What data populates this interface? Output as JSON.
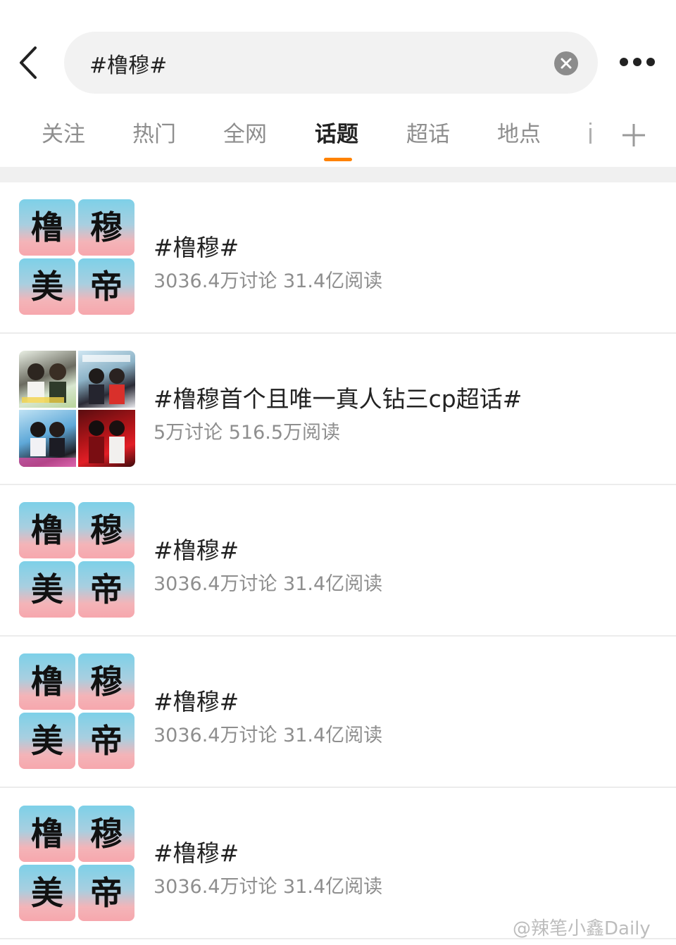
{
  "search": {
    "query": "#橹穆#"
  },
  "tabs": [
    {
      "label": "关注",
      "active": false
    },
    {
      "label": "热门",
      "active": false
    },
    {
      "label": "全网",
      "active": false
    },
    {
      "label": "话题",
      "active": true
    },
    {
      "label": "超话",
      "active": false
    },
    {
      "label": "地点",
      "active": false
    }
  ],
  "topics": [
    {
      "thumb_type": "text-grid",
      "thumb_chars": [
        "橹",
        "穆",
        "美",
        "帝"
      ],
      "title": "#橹穆#",
      "meta": "3036.4万讨论 31.4亿阅读"
    },
    {
      "thumb_type": "photo-collage",
      "title": "#橹穆首个且唯一真人钻三cp超话#",
      "meta": "5万讨论 516.5万阅读"
    },
    {
      "thumb_type": "text-grid",
      "thumb_chars": [
        "橹",
        "穆",
        "美",
        "帝"
      ],
      "title": "#橹穆#",
      "meta": "3036.4万讨论 31.4亿阅读"
    },
    {
      "thumb_type": "text-grid",
      "thumb_chars": [
        "橹",
        "穆",
        "美",
        "帝"
      ],
      "title": "#橹穆#",
      "meta": "3036.4万讨论 31.4亿阅读"
    },
    {
      "thumb_type": "text-grid",
      "thumb_chars": [
        "橹",
        "穆",
        "美",
        "帝"
      ],
      "title": "#橹穆#",
      "meta": "3036.4万讨论 31.4亿阅读"
    }
  ],
  "watermark": "@辣笔小鑫Daily",
  "colors": {
    "accent": "#ff8200",
    "text": "#222222",
    "muted": "#8e8e8e",
    "divider": "#f0f0f0"
  },
  "icons": {
    "back": "chevron-left-icon",
    "clear": "close-circle-icon",
    "more": "more-dots-icon",
    "add_tab": "plus-icon"
  }
}
